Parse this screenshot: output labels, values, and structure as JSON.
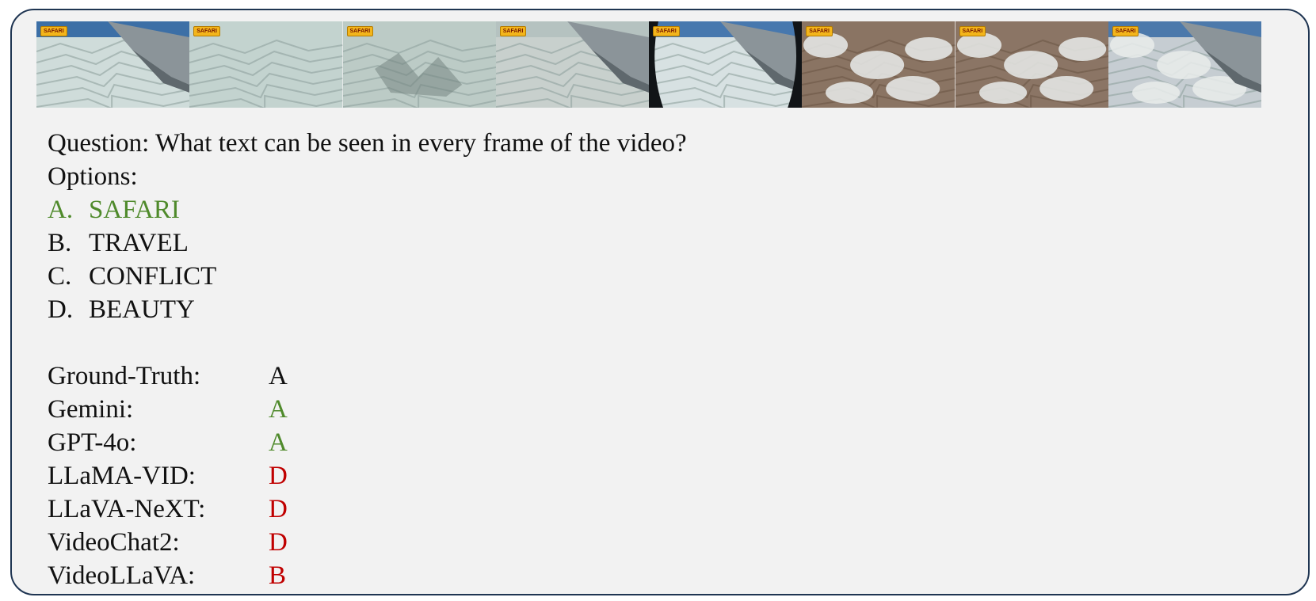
{
  "frames": [
    {
      "badge": "SAFARI",
      "scene": "wing-snow",
      "sky": "#3c6fa6",
      "ground": "#cfdcda"
    },
    {
      "badge": "SAFARI",
      "scene": "snow",
      "sky": "#b9cbc7",
      "ground": "#c3d3cf"
    },
    {
      "badge": "SAFARI",
      "scene": "snow-dark",
      "sky": "#a9bcb6",
      "ground": "#bccbc6"
    },
    {
      "badge": "SAFARI",
      "scene": "wing-snow",
      "sky": "#b5c2c0",
      "ground": "#c8d0cd"
    },
    {
      "badge": "SAFARI",
      "scene": "wing-window",
      "sky": "#4778ae",
      "ground": "#d7e1e2"
    },
    {
      "badge": "SAFARI",
      "scene": "clouds-brown",
      "sky": "#8c8a86",
      "ground": "#8a7463"
    },
    {
      "badge": "SAFARI",
      "scene": "clouds-brown",
      "sky": "#9a9894",
      "ground": "#8b7565"
    },
    {
      "badge": "SAFARI",
      "scene": "wing-clouds",
      "sky": "#4c79ab",
      "ground": "#c6cdd2"
    }
  ],
  "question": "Question: What text can be seen in every frame of the video?",
  "options_label": "Options:",
  "options": [
    {
      "letter": "A.",
      "text": "SAFARI",
      "color": "#4f8a2b"
    },
    {
      "letter": "B.",
      "text": "TRAVEL",
      "color": "#111111"
    },
    {
      "letter": "C.",
      "text": "CONFLICT",
      "color": "#111111"
    },
    {
      "letter": "D.",
      "text": "BEAUTY",
      "color": "#111111"
    }
  ],
  "results": [
    {
      "model": "Ground-Truth:",
      "answer": "A",
      "color": "#111111"
    },
    {
      "model": "Gemini:",
      "answer": "A",
      "color": "#4f8a2b"
    },
    {
      "model": "GPT-4o:",
      "answer": "A",
      "color": "#4f8a2b"
    },
    {
      "model": "LLaMA-VID:",
      "answer": "D",
      "color": "#c00000"
    },
    {
      "model": "LLaVA-NeXT:",
      "answer": "D",
      "color": "#c00000"
    },
    {
      "model": "VideoChat2:",
      "answer": "D",
      "color": "#c00000"
    },
    {
      "model": "VideoLLaVA:",
      "answer": "B",
      "color": "#c00000"
    }
  ],
  "colors": {
    "border": "#1f3552",
    "panel_bg": "#f2f2f2",
    "correct": "#4f8a2b",
    "wrong": "#c00000"
  }
}
